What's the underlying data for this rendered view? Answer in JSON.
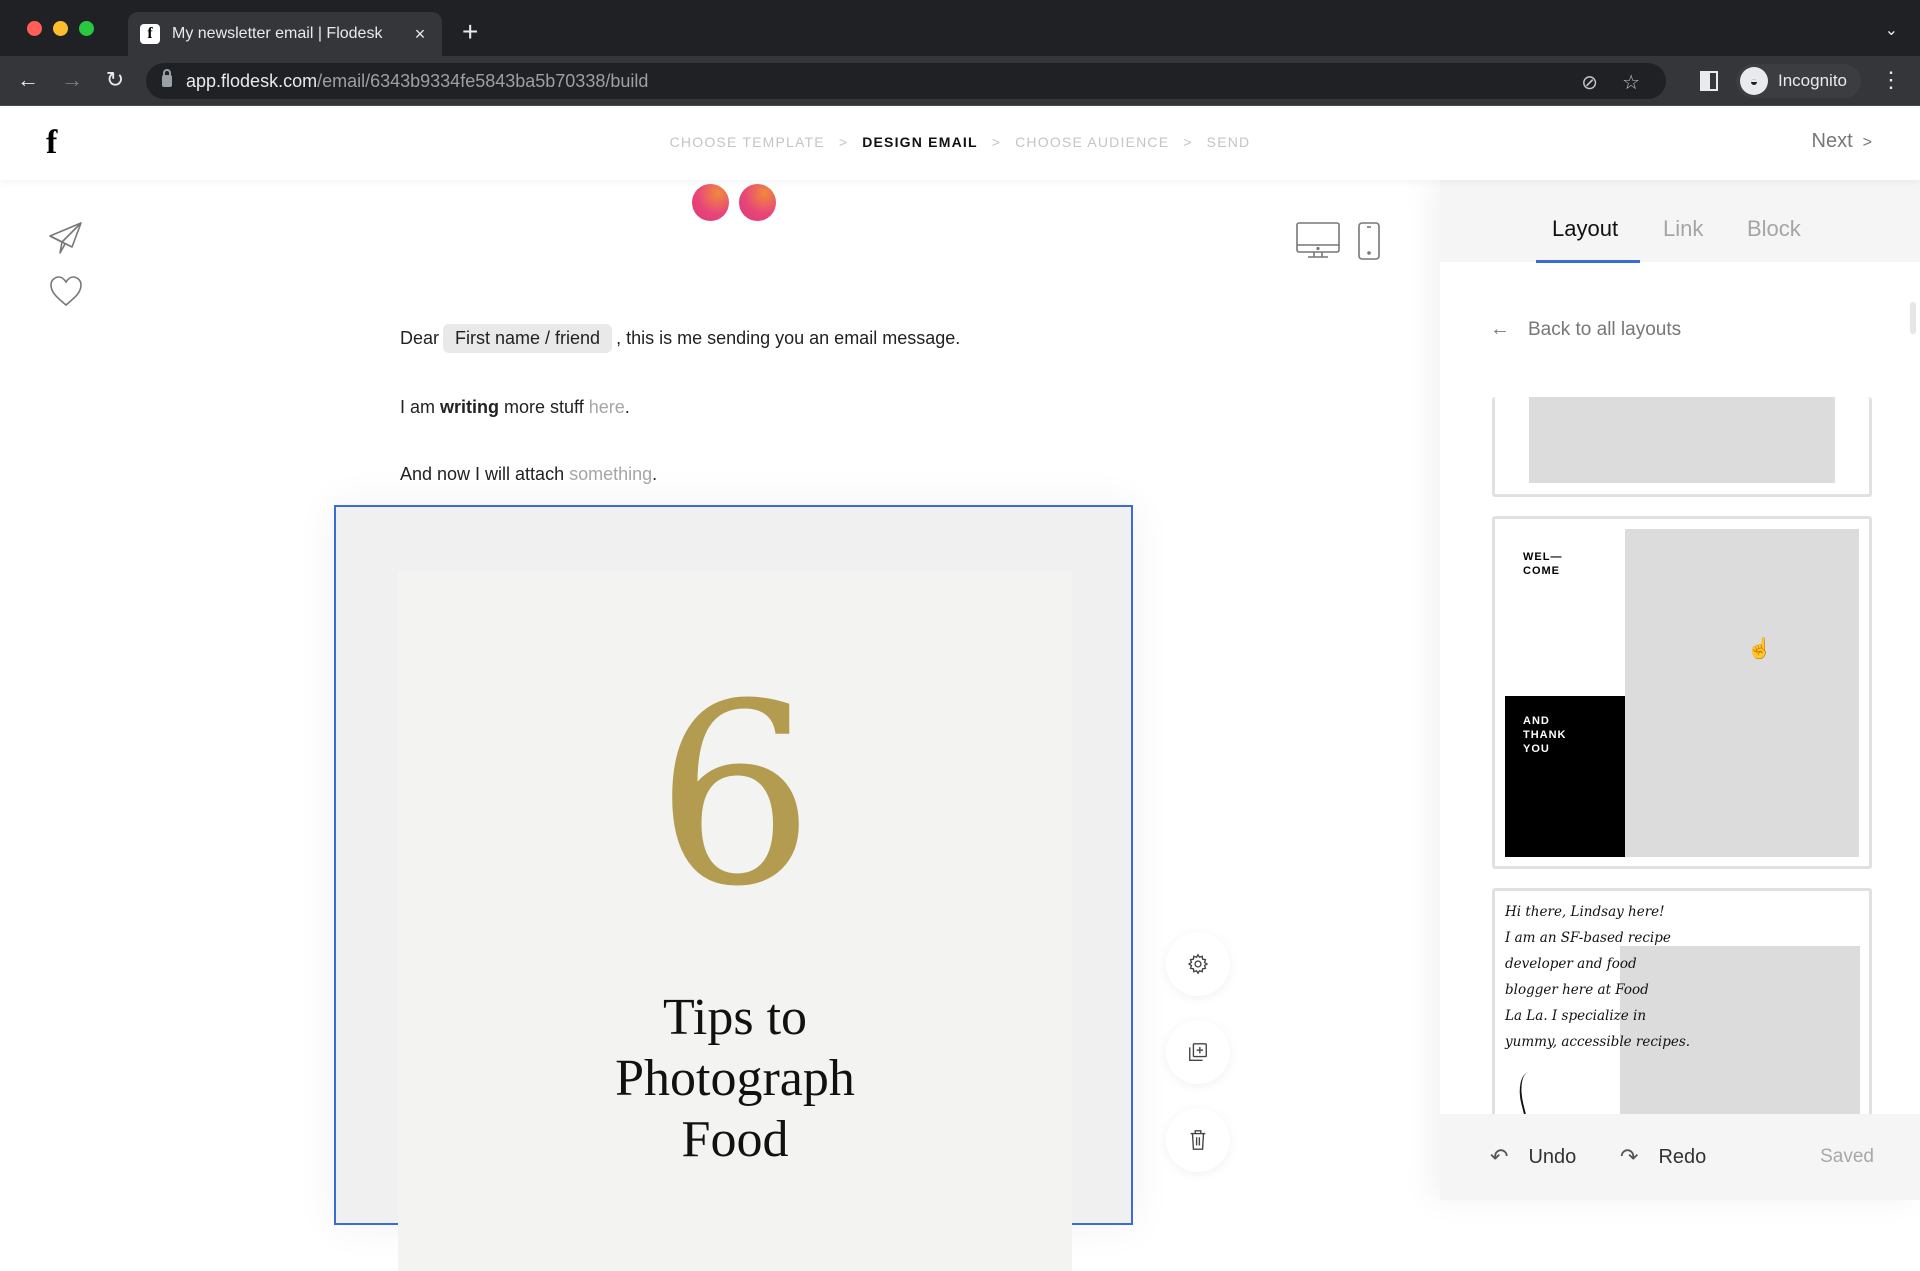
{
  "browser": {
    "tab_title": "My newsletter email | Flodesk",
    "tab_favicon_glyph": "f",
    "close_glyph": "×",
    "new_tab_glyph": "+",
    "tab_list_glyph": "⌄",
    "back_glyph": "←",
    "forward_glyph": "→",
    "reload_glyph": "↻",
    "url_host": "app.flodesk.com",
    "url_path": "/email/6343b9334fe5843ba5b70338/build",
    "eye_off_glyph": "⊘",
    "star_glyph": "☆",
    "incognito_label": "Incognito",
    "incognito_glyph": "◒",
    "menu_glyph": "⋮"
  },
  "header": {
    "logo": "f",
    "steps": [
      {
        "label": "CHOOSE TEMPLATE",
        "active": false
      },
      {
        "label": "DESIGN EMAIL",
        "active": true
      },
      {
        "label": "CHOOSE AUDIENCE",
        "active": false
      },
      {
        "label": "SEND",
        "active": false
      }
    ],
    "step_separator": ">",
    "next_label": "Next",
    "next_chevron": ">"
  },
  "rail": {
    "icons": [
      "paper-plane-icon",
      "heart-icon"
    ]
  },
  "canvas": {
    "view_modes": [
      "desktop",
      "mobile"
    ],
    "line1": {
      "prefix": "Dear",
      "merge_tag": "First name / friend",
      "suffix": ", this is me sending you an email message."
    },
    "line2": {
      "prefix": "I am ",
      "bold": "writing",
      "middle": " more stuff ",
      "link": "here",
      "suffix": "."
    },
    "line3": {
      "prefix": "And now I will attach ",
      "link": "something",
      "suffix": "."
    },
    "block": {
      "number": "6",
      "headline_lines": [
        "Tips to",
        "Photograph",
        "Food"
      ]
    },
    "block_actions": [
      "settings",
      "duplicate",
      "delete"
    ]
  },
  "panel": {
    "tabs": [
      {
        "label": "Layout",
        "active": true
      },
      {
        "label": "Link",
        "active": false
      },
      {
        "label": "Block",
        "active": false
      }
    ],
    "back_label": "Back to all layouts",
    "back_glyph": "←",
    "cards": {
      "welcome_text": "WEL—\nCOME",
      "thanks_text": "AND\nTHANK\nYOU",
      "handwritten_text": "Hi there, Lindsay here!\nI am an SF-based recipe\ndeveloper and food\nblogger here at Food\nLa La. I specialize in\nyummy, accessible recipes."
    },
    "cursor_glyph": "☝",
    "undo_label": "Undo",
    "undo_glyph": "↶",
    "redo_label": "Redo",
    "redo_glyph": "↷",
    "status": "Saved"
  },
  "colors": {
    "accent_blue": "#3b6bd4",
    "gold": "#b39b50",
    "brand_pink": "#e8457a",
    "brand_orange": "#f08a3c"
  }
}
